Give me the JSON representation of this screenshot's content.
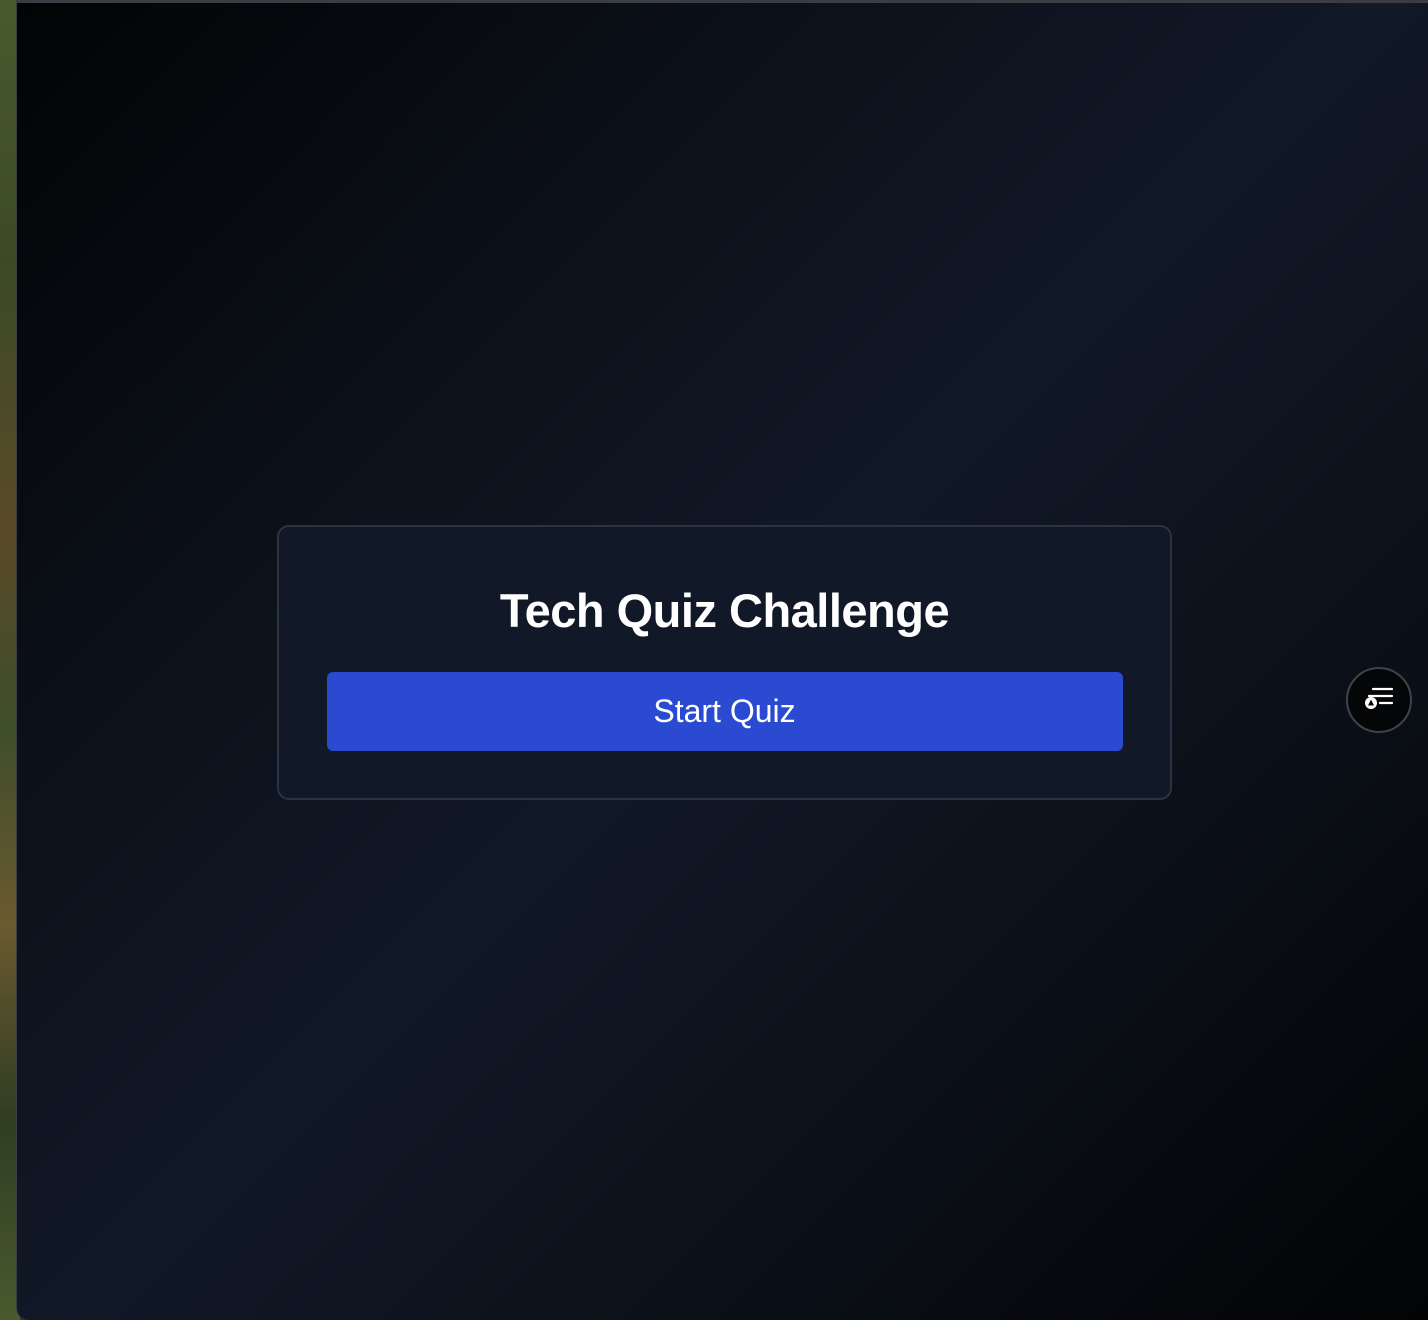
{
  "quiz": {
    "title": "Tech Quiz Challenge",
    "start_label": "Start Quiz"
  },
  "floating_button": {
    "icon": "list-filter-icon"
  },
  "colors": {
    "button_accent": "#2a4bd1",
    "card_background": "#111827",
    "title_text": "#ffffff"
  }
}
